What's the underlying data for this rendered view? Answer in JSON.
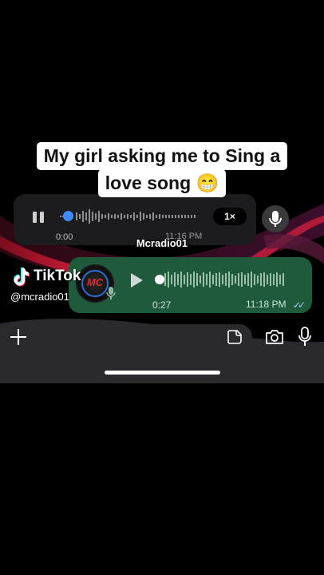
{
  "caption": {
    "line1": "My girl asking me to Sing a",
    "line2": "love song 😁"
  },
  "incoming_voice": {
    "elapsed": "0:00",
    "timestamp": "11:16 PM",
    "speed": "1×",
    "progress": 0.0
  },
  "watermark": "Mcradio01",
  "tiktok": {
    "brand": "TikTok",
    "handle": "@mcradio01"
  },
  "outgoing_voice": {
    "avatar_text": "MC",
    "duration": "0:27",
    "timestamp": "11:18 PM",
    "progress": 0.0
  },
  "input_bar": {
    "message_value": ""
  },
  "colors": {
    "incoming_bubble": "#1c1c1e",
    "outgoing_bubble": "#1f5a3c",
    "playhead_incoming": "#3d8bff",
    "read_ticks": "#9fc7ff"
  },
  "icons": [
    "pause-icon",
    "microphone-icon",
    "play-icon",
    "plus-icon",
    "sticker-icon",
    "camera-icon",
    "tiktok-logo-icon",
    "double-check-icon"
  ]
}
